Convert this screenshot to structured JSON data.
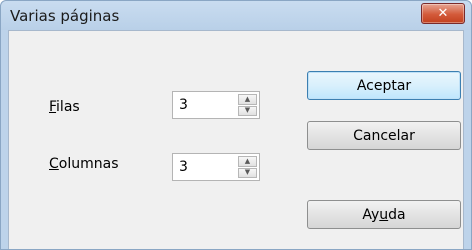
{
  "window": {
    "title": "Varias páginas",
    "close_glyph": "✕"
  },
  "fields": {
    "rows": {
      "label": "Filas",
      "value": "3"
    },
    "columns": {
      "label": "Columnas",
      "value": "3"
    }
  },
  "buttons": {
    "ok": "Aceptar",
    "cancel": "Cancelar",
    "help_pre": "Ay",
    "help_mnemonic": "u",
    "help_post": "da"
  },
  "labels_mnemonic": {
    "rows_first": "F",
    "rows_rest": "ilas",
    "columns_first": "C",
    "columns_rest": "olumnas"
  },
  "icons": {
    "spin_up": "up-arrow-icon",
    "spin_down": "down-arrow-icon",
    "close": "close-icon"
  },
  "colors": {
    "close_button": "#d35a3a",
    "default_button_border": "#3c7fb1"
  }
}
